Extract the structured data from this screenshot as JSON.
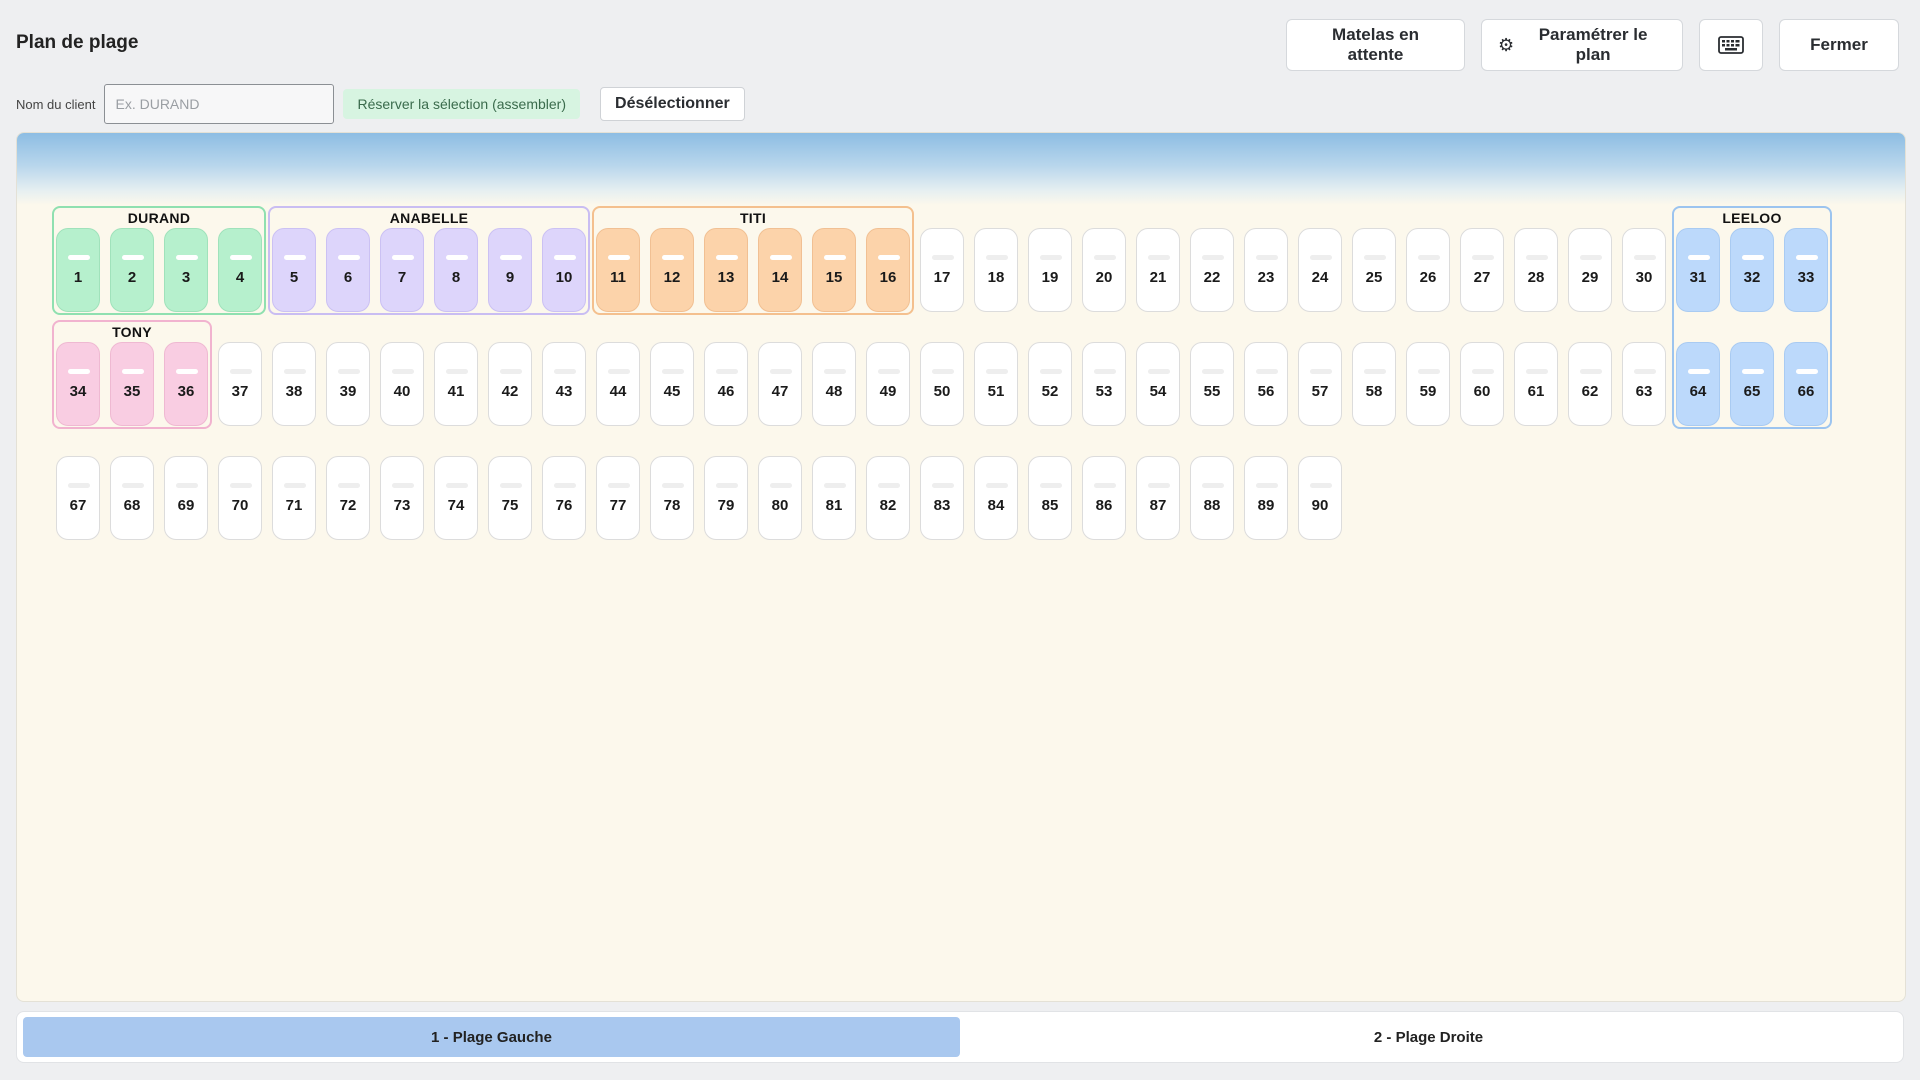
{
  "header": {
    "title": "Plan de plage",
    "waiting_label": "Matelas en attente",
    "settings_label": "Paramétrer le plan",
    "settings_icon": "gear-icon",
    "keyboard_icon": "keyboard-icon",
    "close_label": "Fermer"
  },
  "client": {
    "label": "Nom du client",
    "placeholder": "Ex. DURAND",
    "value": "",
    "reserve_label": "Réserver la sélection (assembler)",
    "deselect_label": "Désélectionner"
  },
  "colors": {
    "green": "#b6f0cd",
    "purple": "#ddd5fb",
    "orange": "#fcd3aa",
    "pink": "#f9cde2",
    "blue": "#bcd9fb",
    "free": "#ffffff",
    "active_tab": "#a9c8ef"
  },
  "groups": [
    {
      "name": "DURAND",
      "color": "green",
      "mats": [
        1,
        2,
        3,
        4
      ]
    },
    {
      "name": "ANABELLE",
      "color": "purple",
      "mats": [
        5,
        6,
        7,
        8,
        9,
        10
      ]
    },
    {
      "name": "TITI",
      "color": "orange",
      "mats": [
        11,
        12,
        13,
        14,
        15,
        16
      ]
    },
    {
      "name": "LEELOO",
      "color": "blue",
      "mats": [
        31,
        32,
        33,
        64,
        65,
        66
      ]
    },
    {
      "name": "TONY",
      "color": "pink",
      "mats": [
        34,
        35,
        36
      ]
    }
  ],
  "rows": [
    [
      "1",
      "2",
      "3",
      "4",
      "5",
      "6",
      "7",
      "8",
      "9",
      "10",
      "11",
      "12",
      "13",
      "14",
      "15",
      "16",
      "17",
      "18",
      "19",
      "20",
      "21",
      "22",
      "23",
      "24",
      "25",
      "26",
      "27",
      "28",
      "29",
      "30",
      "31",
      "32",
      "33"
    ],
    [
      "34",
      "35",
      "36",
      "37",
      "38",
      "39",
      "40",
      "41",
      "42",
      "43",
      "44",
      "45",
      "46",
      "47",
      "48",
      "49",
      "50",
      "51",
      "52",
      "53",
      "54",
      "55",
      "56",
      "57",
      "58",
      "59",
      "60",
      "61",
      "62",
      "63",
      "64",
      "65",
      "66"
    ],
    [
      "67",
      "68",
      "69",
      "70",
      "71",
      "72",
      "73",
      "74",
      "75",
      "76",
      "77",
      "78",
      "79",
      "80",
      "81",
      "82",
      "83",
      "84",
      "85",
      "86",
      "87",
      "88",
      "89",
      "90"
    ]
  ],
  "tabs": [
    {
      "label": "1 - Plage Gauche",
      "active": true
    },
    {
      "label": "2 - Plage Droite",
      "active": false
    }
  ]
}
